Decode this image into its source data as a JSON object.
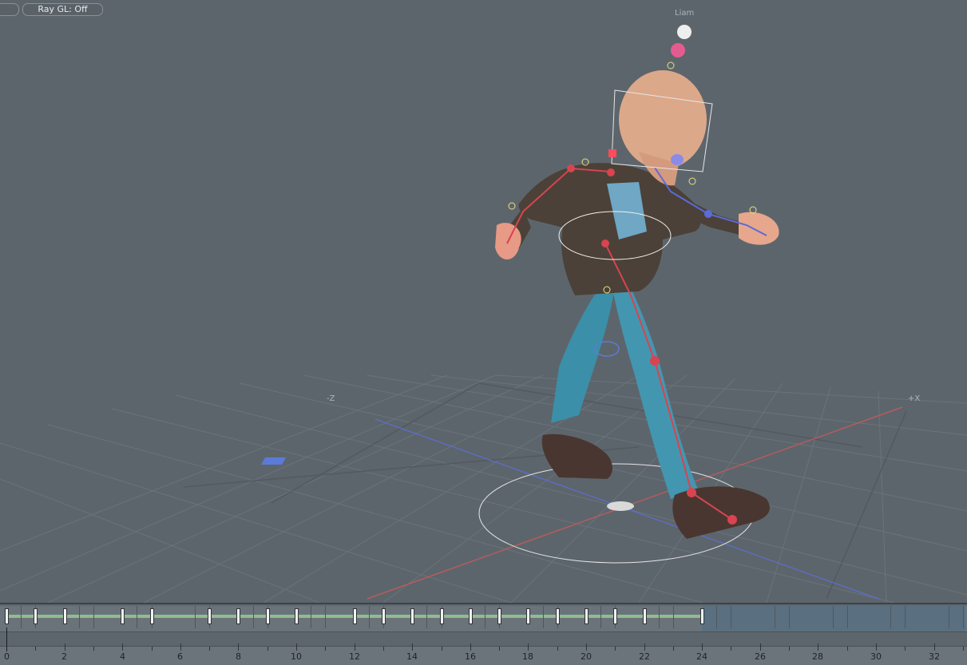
{
  "toolbar": {
    "left_pill_label": "",
    "raygl_label": "Ray GL: Off"
  },
  "viewport": {
    "character_name": "Liam",
    "axis_neg_z": "-Z",
    "axis_pos_x": "+X"
  },
  "timeline": {
    "current_frame": 0,
    "range_end": 24,
    "keyframes": [
      0,
      1,
      2,
      4,
      5,
      7,
      8,
      9,
      10,
      12,
      13,
      14,
      15,
      16,
      17,
      18,
      19,
      20,
      21,
      22,
      24
    ],
    "ruler_labels": [
      "0",
      "2",
      "4",
      "6",
      "8",
      "10",
      "12",
      "14",
      "16",
      "18",
      "20",
      "22",
      "24",
      "26",
      "28",
      "30",
      "32"
    ]
  },
  "colors": {
    "viewport_bg": "#5d656c",
    "grid": "#6a7279",
    "x_axis": "#c8595a",
    "z_axis": "#5a6fd0",
    "key_range": "#8fbc92",
    "rig_left": "#d8444f",
    "rig_right": "#5b6bd8"
  }
}
